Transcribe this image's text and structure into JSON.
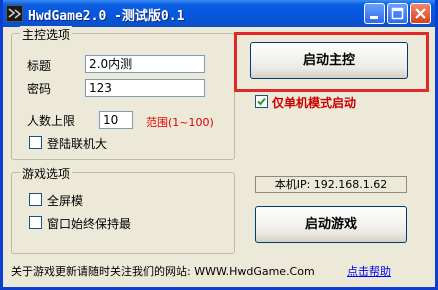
{
  "window": {
    "title": "HwdGame2.0 -测试版0.1"
  },
  "host_group": {
    "legend": "主控选项",
    "title_label": "标题",
    "title_value": "2.0内测",
    "password_label": "密码",
    "password_value": "123",
    "max_players_label": "人数上限",
    "max_players_value": "10",
    "range_text": "范围(1~100)",
    "login_lobby_label": "登陆联机大",
    "login_lobby_checked": false
  },
  "game_group": {
    "legend": "游戏选项",
    "fullscreen_label": "全屏模",
    "fullscreen_checked": false,
    "window_topmost_label": "窗口始终保持最",
    "window_topmost_checked": false
  },
  "buttons": {
    "start_host": "启动主控",
    "start_game": "启动游戏"
  },
  "single_mode": {
    "label": "仅单机模式启动",
    "checked": true
  },
  "local_ip": "本机IP: 192.168.1.62",
  "footer": {
    "notice": "关于游戏更新请随时关注我们的网站: WWW.HwdGame.Com",
    "help_link": "点击帮助"
  },
  "colors": {
    "title_bar": "#0a5ee0",
    "window_face": "#ece9d8",
    "highlight_outline": "#e02a2a",
    "range_text": "#e00000",
    "single_mode_text": "#cc0000",
    "link": "#0000ee"
  }
}
